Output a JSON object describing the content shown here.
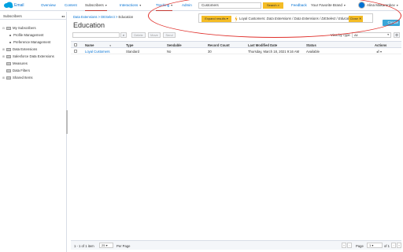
{
  "nav": {
    "app_name": "Email",
    "items": [
      "Overview",
      "Content",
      "Subscribers",
      "Interactions",
      "Tracking",
      "Admin"
    ],
    "search_value": "Customers",
    "search_button": "Search",
    "feedback": "Feedback",
    "brand": "Your Favorite Brand",
    "user": "Alina Makarenkov"
  },
  "sidebar": {
    "title": "Subscribers",
    "items": [
      "My Subscribers",
      "Profile Management",
      "Preference Management",
      "Data Extensions",
      "Salesforce Data Extensions",
      "Measures",
      "Data Filters",
      "Shared Items"
    ]
  },
  "breadcrumb": {
    "parts": [
      "Data Extensions",
      "DESelect"
    ],
    "current": "Education",
    "sep": " > "
  },
  "page_title": "Education",
  "notice": {
    "expand_label": "Expand results",
    "text_prefix": "Loyal Customers:",
    "text_path": "Data Extensions / Data Extensions / DESelect / Education /",
    "close_label": "Close"
  },
  "create_label": "Create",
  "toolbar": {
    "delete": "Delete",
    "move": "Move",
    "send": "Send",
    "view_by_label": "View by Type",
    "view_by_value": "All"
  },
  "table": {
    "columns": [
      "Name",
      "Type",
      "Sendable",
      "Record Count",
      "Last Modified Date",
      "Status",
      "Actions"
    ],
    "rows": [
      [
        "Loyal Customers",
        "Standard",
        "No",
        "30",
        "Thursday, March 18, 2021 9:16 AM",
        "Available"
      ]
    ]
  },
  "footer": {
    "range": "1 - 1 of 1 item",
    "per_page_value": "25",
    "per_page_label": "Per Page",
    "page_label": "Page",
    "page_value": "1",
    "of_label": "of 1"
  },
  "colors": {
    "accent": "#0070d2",
    "button_yellow": "#f4bc25",
    "annotation_red": "#e0302b"
  }
}
